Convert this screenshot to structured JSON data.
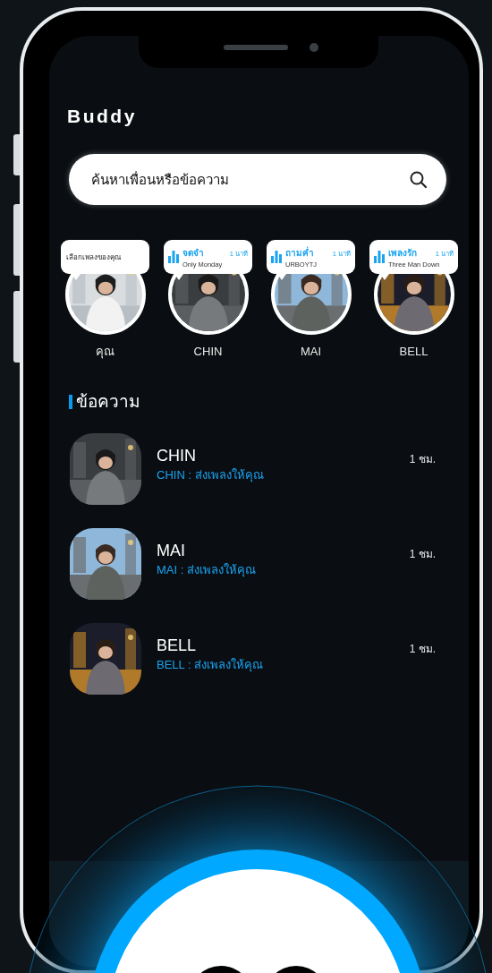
{
  "app": {
    "title": "Buddy"
  },
  "search": {
    "placeholder": "ค้นหาเพื่อนหรือข้อความ"
  },
  "stories": [
    {
      "name": "คุณ",
      "bubble": {
        "kind": "prompt",
        "text": "เลือกเพลงของคุณ"
      }
    },
    {
      "name": "CHIN",
      "bubble": {
        "kind": "song",
        "title": "จดจำ",
        "duration": "1 นาที",
        "artist": "Only Monday"
      }
    },
    {
      "name": "MAI",
      "bubble": {
        "kind": "song",
        "title": "ถามค่ำ",
        "duration": "1 นาที",
        "artist": "URBOYTJ"
      }
    },
    {
      "name": "BELL",
      "bubble": {
        "kind": "song",
        "title": "เพลงรัก",
        "duration": "1 นาที",
        "artist": "Three Man Down"
      }
    }
  ],
  "messages_section": {
    "title": "ข้อความ"
  },
  "messages": [
    {
      "name": "CHIN",
      "preview": "CHIN : ส่งเพลงให้คุณ",
      "time": "1 ชม."
    },
    {
      "name": "MAI",
      "preview": "MAI : ส่งเพลงให้คุณ",
      "time": "1 ชม."
    },
    {
      "name": "BELL",
      "preview": "BELL : ส่งเพลงให้คุณ",
      "time": "1 ชม."
    }
  ]
}
